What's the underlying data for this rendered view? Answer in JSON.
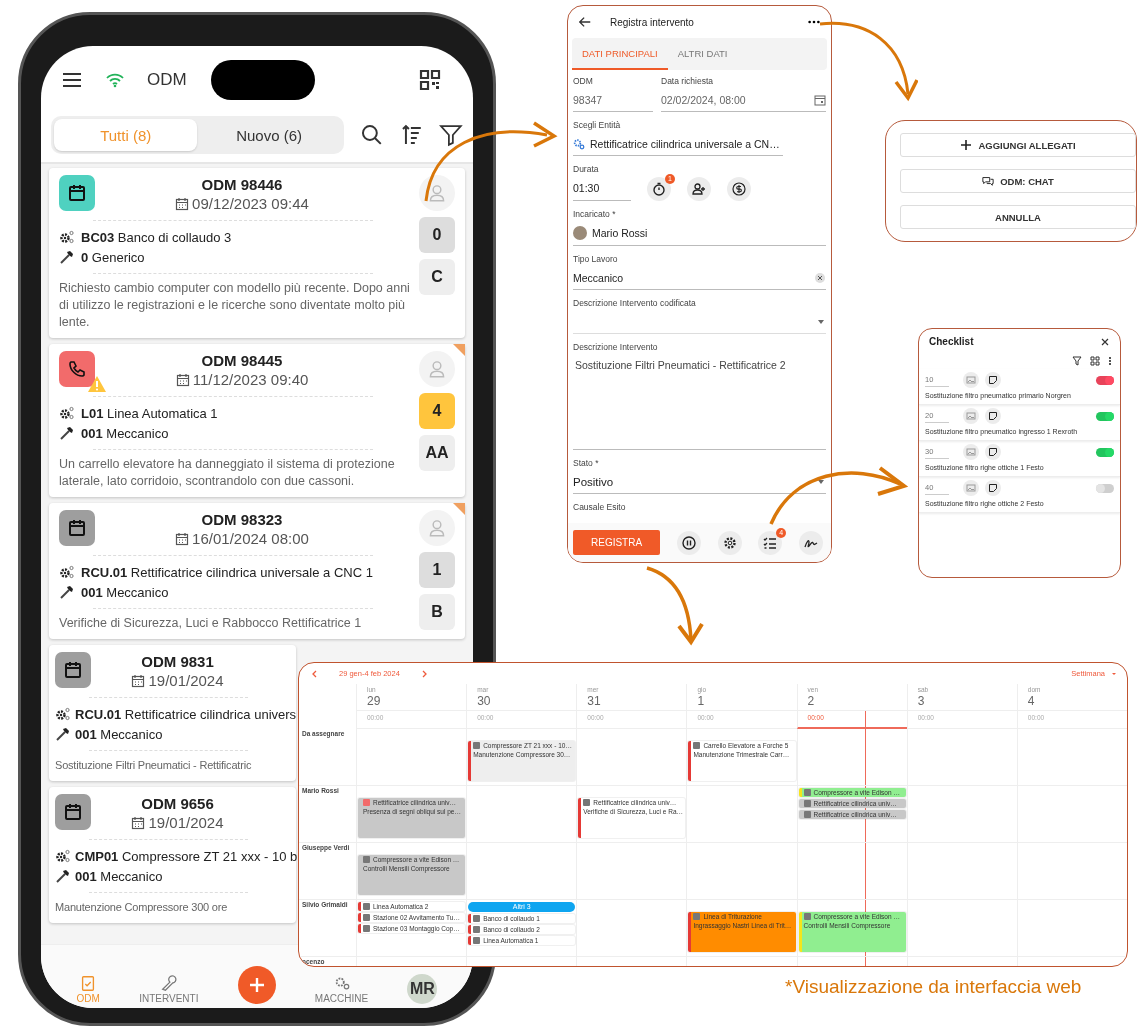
{
  "phone": {
    "title": "ODM",
    "tabs": [
      {
        "label": "Tutti (8)",
        "selected": true
      },
      {
        "label": "Nuovo (6)",
        "selected": false
      }
    ],
    "cards": [
      {
        "kind": "calendar",
        "color": "#4fd1c0",
        "warning": false,
        "flagged": false,
        "title": "ODM 98446",
        "date": "09/12/2023 09:44",
        "machine_code": "BC03",
        "machine": "Banco di collaudo 3",
        "work_code": "0",
        "work": "Generico",
        "description": "Richiesto cambio computer con modello più recente. Dopo anni di utilizzo le registrazioni e le ricerche sono diventate molto più lente.",
        "side": {
          "count": "0",
          "color": "#dddddd",
          "letter": "C"
        }
      },
      {
        "kind": "phone",
        "color": "#f26b6b",
        "warning": true,
        "flagged": true,
        "title": "ODM 98445",
        "date": "11/12/2023 09:40",
        "machine_code": "L01",
        "machine": "Linea Automatica 1",
        "work_code": "001",
        "work": "Meccanico",
        "description": "Un carrello elevatore ha danneggiato il sistema di protezione laterale, lato corridoio, scontrandolo con due cassoni.",
        "side": {
          "count": "4",
          "color": "#ffc53d",
          "letter": "AA"
        }
      },
      {
        "kind": "calendar",
        "color": "#9e9e9e",
        "warning": false,
        "flagged": true,
        "title": "ODM 98323",
        "date": "16/01/2024 08:00",
        "machine_code": "RCU.01",
        "machine": "Rettificatrice cilindrica universale a CNC 1",
        "work_code": "001",
        "work": "Meccanico",
        "description": "Verifiche di Sicurezza, Luci e Rabbocco Rettificatrice 1",
        "side": {
          "count": "1",
          "color": "#dddddd",
          "letter": "B"
        }
      },
      {
        "kind": "calendar",
        "color": "#9e9e9e",
        "warning": false,
        "flagged": false,
        "title": "ODM 9831",
        "date": "19/01/2024",
        "machine_code": "RCU.01",
        "machine": "Rettificatrice cilindrica univers",
        "work_code": "001",
        "work": "Meccanico",
        "description": "Sostituzione Filtri Pneumatici - Rettificatric"
      },
      {
        "kind": "calendar",
        "color": "#9e9e9e",
        "warning": false,
        "flagged": false,
        "title": "ODM 9656",
        "date": "19/01/2024",
        "machine_code": "CMP01",
        "machine": "Compressore ZT 21 xxx - 10 b",
        "work_code": "001",
        "work": "Meccanico",
        "description": "Manutenzione Compressore 300 ore"
      }
    ],
    "nav": [
      {
        "kind": "clipboard",
        "label": "ODM",
        "selected": true
      },
      {
        "kind": "wrench",
        "label": "INTERVENTI",
        "selected": false
      },
      {
        "kind": "fab"
      },
      {
        "kind": "gears",
        "label": "MACCHINE",
        "selected": false
      },
      {
        "kind": "avatar",
        "label": "MR"
      }
    ]
  },
  "form": {
    "title": "Registra intervento",
    "tabs": [
      {
        "label": "DATI PRINCIPALI",
        "selected": true
      },
      {
        "label": "ALTRI DATI",
        "selected": false
      }
    ],
    "odm": {
      "label": "ODM",
      "value": "98347"
    },
    "date": {
      "label": "Data richiesta",
      "value": "02/02/2024, 08:00"
    },
    "entity": {
      "label": "Scegli Entità",
      "value": "Rettificatrice cilindrica universale a CN…"
    },
    "duration": {
      "label": "Durata",
      "value": "01:30",
      "timer_badge": "1"
    },
    "assignee": {
      "label": "Incaricato *",
      "value": "Mario Rossi"
    },
    "work_type": {
      "label": "Tipo Lavoro",
      "value": "Meccanico"
    },
    "coded": {
      "label": "Descrizione Intervento codificata"
    },
    "description": {
      "label": "Descrizione Intervento",
      "value": "Sostituzione Filtri Pneumatici - Rettificatrice 2"
    },
    "state": {
      "label": "Stato *",
      "value": "Positivo"
    },
    "reason": {
      "label": "Causale Esito"
    },
    "submit": "REGISTRA",
    "checklist_badge": "4"
  },
  "menu": {
    "buttons": [
      {
        "kind": "plus",
        "label": "AGGIUNGI ALLEGATI"
      },
      {
        "kind": "chat",
        "label": "ODM: CHAT"
      },
      {
        "kind": "plain",
        "label": "ANNULLA"
      }
    ]
  },
  "checklist": {
    "title": "Checklist",
    "items": [
      {
        "number": "10",
        "on": true,
        "color": "#e8435a",
        "text": "Sostituzione filtro pneumatico primario Norgren"
      },
      {
        "number": "20",
        "on": true,
        "color": "#22c55e",
        "text": "Sostituzione filtro pneumatico ingresso 1 Rexroth"
      },
      {
        "number": "30",
        "on": true,
        "color": "#22c55e",
        "text": "Sostituzione filtro righe ottiche 1 Festo"
      },
      {
        "number": "40",
        "on": false,
        "color": "#cfcfcf",
        "text": "Sostituzione filtro righe ottiche 2 Festo"
      }
    ]
  },
  "calendar": {
    "range": "29 gen-4 feb 2024",
    "view": "Settimana",
    "days": [
      {
        "weekday": "lun",
        "date": "29",
        "time": "00:00",
        "today": false
      },
      {
        "weekday": "mar",
        "date": "30",
        "time": "00:00",
        "today": false
      },
      {
        "weekday": "mer",
        "date": "31",
        "time": "00:00",
        "today": false
      },
      {
        "weekday": "gio",
        "date": "1",
        "time": "00:00",
        "today": false
      },
      {
        "weekday": "ven",
        "date": "2",
        "time": "00:00",
        "today": true
      },
      {
        "weekday": "sab",
        "date": "3",
        "time": "00:00",
        "today": false
      },
      {
        "weekday": "dom",
        "date": "4",
        "time": "00:00",
        "today": false
      }
    ],
    "rows": [
      {
        "name": "Da assegnare",
        "cells": [
          {},
          {
            "events": [
              {
                "kind": "calendar",
                "color": "#eeeeee",
                "bar": {
                  "color": "#e53935"
                },
                "title": "Compressore ZT 21 xxx - 10…",
                "subtitle": "Manutenzione Compressore 30…"
              }
            ]
          },
          {},
          {
            "events": [
              {
                "kind": "calendar",
                "color": "#ffffff",
                "bar": {
                  "color": "#e53935"
                },
                "title": "Carrello Elevatore a Forche 5",
                "subtitle": "Manutenzione Trimestrale Carr…"
              }
            ]
          },
          {},
          {},
          {}
        ]
      },
      {
        "name": "Mario Rossi",
        "cells": [
          {
            "events": [
              {
                "kind": "phone",
                "color": "#c8c8c8",
                "title": "Rettificatrice cilindrica univ…",
                "subtitle": "Presenza di segni obliqui sul pe…"
              }
            ]
          },
          {},
          {
            "events": [
              {
                "kind": "calendar",
                "color": "#ffffff",
                "bar": {
                  "color": "#e53935"
                },
                "title": "Rettificatrice cilindrica univ…",
                "subtitle": "Verifiche di Sicurezza, Luci e Ra…"
              }
            ]
          },
          {},
          {
            "events": [
              {
                "kind": "calendar",
                "color": "#90ee90",
                "bar": {
                  "color": "#f5e51b"
                },
                "title": "Compressore a vite Edison …"
              },
              {
                "kind": "calendar",
                "color": "#c8c8c8",
                "title": "Rettificatrice cilindrica univ…"
              },
              {
                "kind": "calendar",
                "color": "#c8c8c8",
                "title": "Rettificatrice cilindrica univ…"
              }
            ]
          },
          {},
          {}
        ]
      },
      {
        "name": "Giuseppe Verdi",
        "cells": [
          {
            "events": [
              {
                "kind": "calendar",
                "color": "#c8c8c8",
                "title": "Compressore a vite Edison …",
                "subtitle": "Controlli Mensili Compressore"
              }
            ]
          },
          {},
          {},
          {},
          {},
          {},
          {}
        ]
      },
      {
        "name": "Silvio Grimaldi",
        "cells": [
          {
            "events": [
              {
                "kind": "calendar",
                "color": "#ffffff",
                "bar": {
                  "color": "#e53935"
                },
                "title": "Linea Automatica 2"
              },
              {
                "kind": "calendar",
                "color": "#ffffff",
                "bar": {
                  "color": "#e53935"
                },
                "title": "Stazione 02 Avvitamento Tu…"
              },
              {
                "kind": "calendar",
                "color": "#ffffff",
                "bar": {
                  "color": "#e53935"
                },
                "title": "Stazione 03 Montaggio Cop…"
              }
            ]
          },
          {
            "more": "Altri 3",
            "events": [
              {
                "kind": "calendar",
                "color": "#ffffff",
                "bar": {
                  "color": "#e53935"
                },
                "title": "Banco di collaudo 1"
              },
              {
                "kind": "calendar",
                "color": "#ffffff",
                "bar": {
                  "color": "#e53935"
                },
                "title": "Banco di collaudo 2"
              },
              {
                "kind": "calendar",
                "color": "#ffffff",
                "bar": {
                  "color": "#e53935"
                },
                "title": "Linea Automatica 1"
              }
            ]
          },
          {},
          {
            "events": [
              {
                "kind": "calendar",
                "color": "#ff8c00",
                "bar": {
                  "color": "#e53935"
                },
                "title": "Linea di Triturazione",
                "subtitle": "Ingrassaggio Nastri Linea di Trit…"
              }
            ]
          },
          {
            "events": [
              {
                "kind": "calendar",
                "color": "#90ee90",
                "bar": {
                  "color": "#f5e51b"
                },
                "title": "Compressore a vite Edison …",
                "subtitle": "Controlli Mensili Compressore"
              }
            ]
          },
          {},
          {}
        ]
      },
      {
        "name": "ncenzo",
        "cells": [
          {},
          {},
          {},
          {},
          {},
          {},
          {}
        ]
      }
    ]
  },
  "caption": "*Visualizzazione da interfaccia web"
}
